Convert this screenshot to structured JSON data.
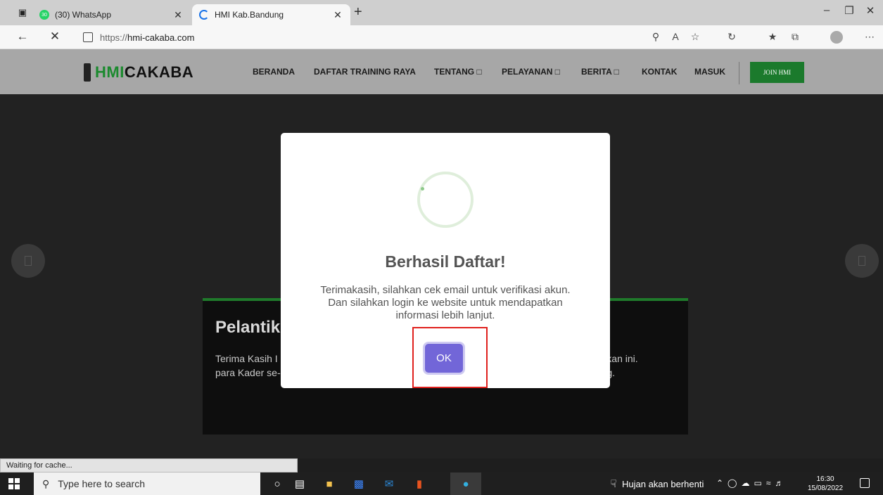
{
  "browser": {
    "tabs": [
      {
        "title": "(30) WhatsApp",
        "badge": "30",
        "favicon_color": "#25d366"
      },
      {
        "title": "HMI Kab.Bandung",
        "favicon_color": "#1a73e8"
      }
    ],
    "url_prefix": "https://",
    "url_domain": "hmi-cakaba.com",
    "status": "Waiting for cache..."
  },
  "site": {
    "logo_hmi": "HMI",
    "logo_cakaba": "CAKABA",
    "menu": [
      {
        "label": "BERANDA"
      },
      {
        "label": "DAFTAR TRAINING RAYA"
      },
      {
        "label": "TENTANG □"
      },
      {
        "label": "PELAYANAN □"
      },
      {
        "label": "BERITA □"
      },
      {
        "label": "KONTAK"
      },
      {
        "label": "MASUK"
      }
    ],
    "join_label": "JOIN HMI",
    "card_title": "Pelantik",
    "card_text": "Terima Kasih I                                                                                          an kegiatan pelantikan ini.                                                                                        para Kader se-Himpun se-                                                                      Kabupaten Bandung."
  },
  "modal": {
    "title": "Berhasil Daftar!",
    "text": "Terimakasih, silahkan cek email untuk verifikasi akun. Dan silahkan login ke website untuk mendapatkan informasi lebih lanjut.",
    "ok_label": "OK",
    "ok_color": "#7266d8",
    "highlight_color": "#e0201d"
  },
  "taskbar": {
    "search_placeholder": "Type here to search",
    "weather": "Hujan akan berhenti",
    "time": "16:30",
    "date": "15/08/2022"
  }
}
